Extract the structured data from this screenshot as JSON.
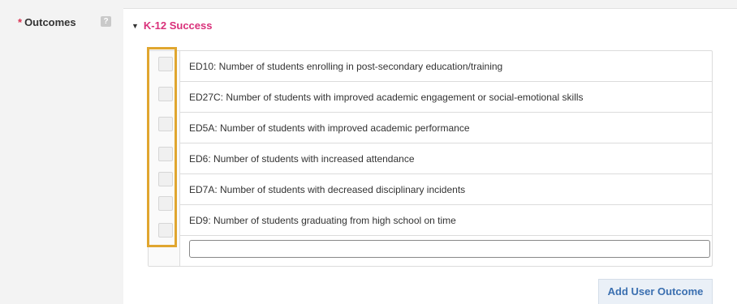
{
  "field": {
    "required_marker": "*",
    "label": "Outcomes",
    "help_icon_glyph": "?"
  },
  "section": {
    "caret_glyph": "▼",
    "title": "K-12 Success"
  },
  "outcomes": [
    {
      "label": "ED10: Number of students enrolling in post-secondary education/training",
      "checked": false
    },
    {
      "label": "ED27C: Number of students with improved academic engagement or social-emotional skills",
      "checked": false
    },
    {
      "label": "ED5A: Number of students with improved academic performance",
      "checked": false
    },
    {
      "label": "ED6: Number of students with increased attendance",
      "checked": false
    },
    {
      "label": "ED7A: Number of students with decreased disciplinary incidents",
      "checked": false
    },
    {
      "label": "ED9: Number of students graduating from high school on time",
      "checked": false
    }
  ],
  "new_outcome": {
    "value": "",
    "placeholder": ""
  },
  "actions": {
    "add_user_outcome": "Add User Outcome"
  },
  "colors": {
    "section_title": "#d9307a",
    "highlight": "#e0a62f",
    "button_text": "#3a6fb0",
    "required": "#d9304f"
  }
}
